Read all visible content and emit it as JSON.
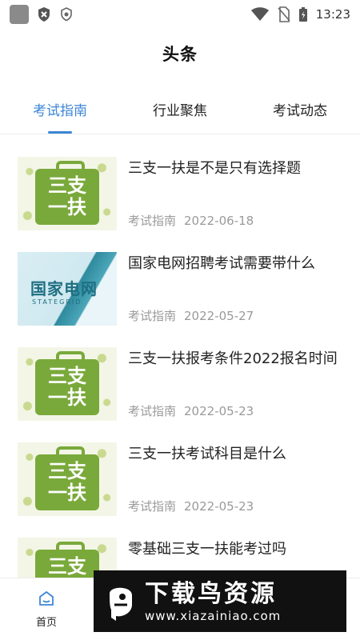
{
  "status_bar": {
    "time": "13:23",
    "icons": [
      "app-icon",
      "shield-x-icon",
      "shield-icon",
      "wifi-icon",
      "no-sim-icon",
      "battery-charging-icon"
    ]
  },
  "header": {
    "title": "头条"
  },
  "tabs": [
    {
      "label": "考试指南",
      "active": true
    },
    {
      "label": "行业聚焦",
      "active": false
    },
    {
      "label": "考试动态",
      "active": false
    }
  ],
  "articles": [
    {
      "title": "三支一扶是不是只有选择题",
      "category": "考试指南",
      "date": "2022-06-18",
      "thumb": "三支一扶",
      "thumb_style": "sanzhi"
    },
    {
      "title": "国家电网招聘考试需要带什么",
      "category": "考试指南",
      "date": "2022-05-27",
      "thumb": "国家电网",
      "thumb_sub": "STATEGRID",
      "thumb_style": "stategrid"
    },
    {
      "title": "三支一扶报考条件2022报名时间",
      "category": "考试指南",
      "date": "2022-05-23",
      "thumb": "三支一扶",
      "thumb_style": "sanzhi"
    },
    {
      "title": "三支一扶考试科目是什么",
      "category": "考试指南",
      "date": "2022-05-23",
      "thumb": "三支一扶",
      "thumb_style": "sanzhi"
    },
    {
      "title": "零基础三支一扶能考过吗",
      "category": "",
      "date": "",
      "thumb": "三支一扶",
      "thumb_style": "sanzhi"
    }
  ],
  "bottom_nav": {
    "home_label": "首页",
    "home_icon": "home-icon"
  },
  "watermark": {
    "brand": "下载鸟资源",
    "url": "www.xiazainiao.com"
  },
  "colors": {
    "accent": "#3c86d6",
    "meta": "#9a9a9a",
    "thumb_green": "#7aa93b"
  }
}
